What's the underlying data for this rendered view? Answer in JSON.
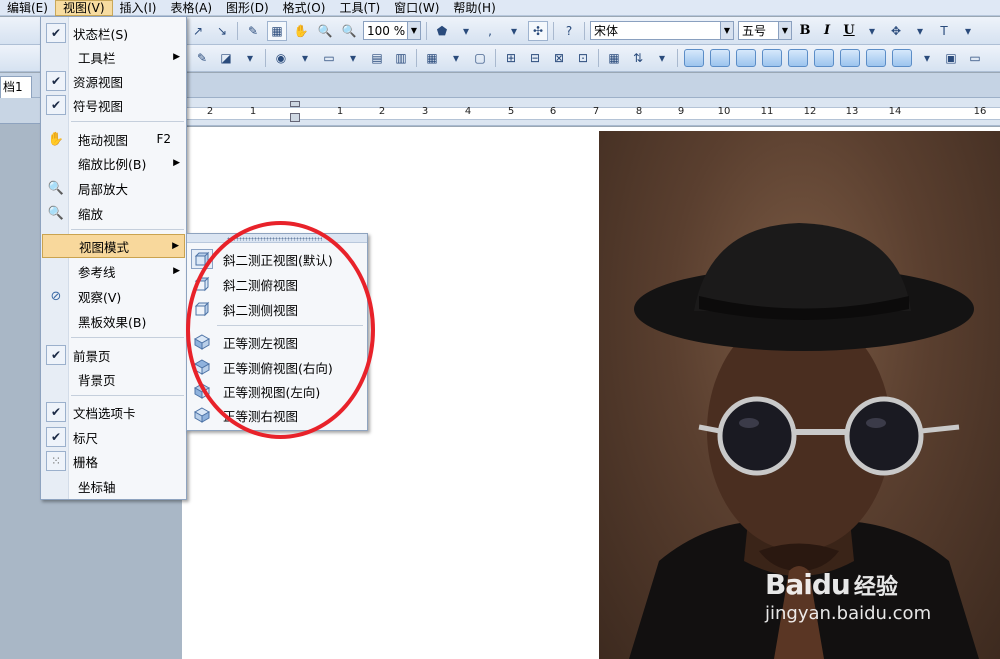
{
  "menubar": {
    "items": [
      "编辑(E)",
      "视图(V)",
      "插入(I)",
      "表格(A)",
      "图形(D)",
      "格式(O)",
      "工具(T)",
      "窗口(W)",
      "帮助(H)"
    ],
    "active_index": 1
  },
  "toolbar": {
    "zoom": "100 %",
    "font_name": "宋体",
    "font_size": "五号",
    "bold": "B",
    "italic": "I",
    "underline": "U"
  },
  "document_tab": "档1",
  "ruler": {
    "labels": [
      "2",
      "1",
      "1",
      "2",
      "3",
      "4",
      "5",
      "6",
      "7",
      "8",
      "9",
      "10",
      "11",
      "12",
      "13",
      "14",
      "16"
    ]
  },
  "view_menu": {
    "items": [
      {
        "label": "状态栏(S)",
        "checked": true
      },
      {
        "label": "工具栏",
        "submenu": true
      },
      {
        "label": "资源视图",
        "checked": true
      },
      {
        "label": "符号视图",
        "checked": true
      },
      {
        "label": "拖动视图",
        "shortcut": "F2",
        "icon": "hand-icon"
      },
      {
        "label": "缩放比例(B)",
        "submenu": true
      },
      {
        "label": "局部放大",
        "icon": "magnifier-icon"
      },
      {
        "label": "缩放",
        "icon": "zoom-icon"
      },
      {
        "label": "视图模式",
        "submenu": true,
        "highlighted": true
      },
      {
        "label": "参考线",
        "submenu": true
      },
      {
        "label": "观察(V)",
        "icon": "observe-icon"
      },
      {
        "label": "黑板效果(B)"
      },
      {
        "label": "前景页",
        "checked": true
      },
      {
        "label": "背景页"
      },
      {
        "label": "文档选项卡",
        "checked": true
      },
      {
        "label": "标尺",
        "checked": true
      },
      {
        "label": "栅格",
        "icon": "grid-icon"
      },
      {
        "label": "坐标轴"
      }
    ]
  },
  "view_mode_submenu": {
    "items": [
      {
        "label": "斜二测正视图(默认)",
        "selected": true
      },
      {
        "label": "斜二测俯视图"
      },
      {
        "label": "斜二测侧视图"
      },
      {
        "label": "正等测左视图"
      },
      {
        "label": "正等测俯视图(右向)"
      },
      {
        "label": "正等测视图(左向)"
      },
      {
        "label": "正等测右视图"
      }
    ]
  },
  "watermark": {
    "logo_left": "Bai",
    "logo_right": "du",
    "cn": "经验",
    "url": "jingyan.baidu.com"
  },
  "colors": {
    "menu_highlight": "#f8d89c",
    "annotation_circle": "#e8222a"
  }
}
